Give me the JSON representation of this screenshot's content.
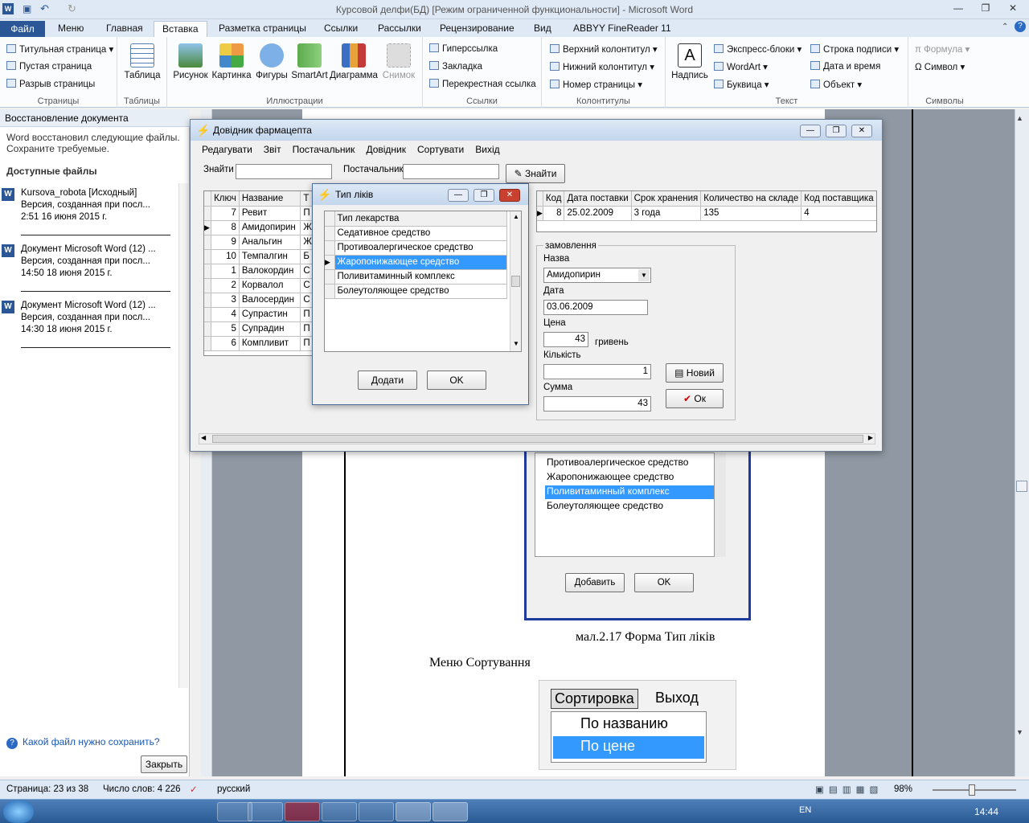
{
  "word": {
    "title": "Курсовой делфи(БД) [Режим ограниченной функциональности] - Microsoft Word",
    "tabs": [
      "Файл",
      "Меню",
      "Главная",
      "Вставка",
      "Разметка страницы",
      "Ссылки",
      "Рассылки",
      "Рецензирование",
      "Вид",
      "ABBYY FineReader 11"
    ],
    "active_tab": "Вставка",
    "ribbon": {
      "pages": {
        "label": "Страницы",
        "items": [
          "Титульная страница",
          "Пустая страница",
          "Разрыв страницы"
        ]
      },
      "tables": {
        "label": "Таблицы",
        "item": "Таблица"
      },
      "illustrations": {
        "label": "Иллюстрации",
        "items": [
          "Рисунок",
          "Картинка",
          "Фигуры",
          "SmartArt",
          "Диаграмма",
          "Снимок"
        ]
      },
      "links": {
        "label": "Ссылки",
        "items": [
          "Гиперссылка",
          "Закладка",
          "Перекрестная ссылка"
        ]
      },
      "headers": {
        "label": "Колонтитулы",
        "items": [
          "Верхний колонтитул",
          "Нижний колонтитул",
          "Номер страницы"
        ]
      },
      "text": {
        "label": "Текст",
        "big": "Надпись",
        "items": [
          "Экспресс-блоки",
          "WordArt",
          "Буквица",
          "Строка подписи",
          "Дата и время",
          "Объект"
        ]
      },
      "symbols": {
        "label": "Символы",
        "items": [
          "Формула",
          "Символ"
        ]
      }
    },
    "recovery": {
      "header": "Восстановление документа",
      "note": [
        "Word восстановил следующие файлы.",
        "Сохраните требуемые."
      ],
      "available": "Доступные файлы",
      "files": [
        {
          "name": "Kursova_robota  [Исходный]",
          "ver": "Версия, созданная при посл...",
          "time": "2:51 16 июня 2015 г."
        },
        {
          "name": "Документ Microsoft Word (12) ...",
          "ver": "Версия, созданная при посл...",
          "time": "14:50 18 июня 2015 г."
        },
        {
          "name": "Документ Microsoft Word (12) ...",
          "ver": "Версия, созданная при посл...",
          "time": "14:30 18 июня 2015 г."
        }
      ],
      "help": "Какой файл нужно сохранить?",
      "close": "Закрыть"
    },
    "page": {
      "bg_list": [
        "Противоалергическое средство",
        "Жаропонижающее средство",
        "Поливитаминный комплекс",
        "Болеутоляющее средство"
      ],
      "bg_btn_add": "Добавить",
      "bg_btn_ok": "OK",
      "caption": "мал.2.17 Форма  Тип ліків",
      "para": "Меню Сортування",
      "img_menu": [
        "Сортировка",
        "Выход"
      ],
      "img_items": [
        "По названию",
        "По цене"
      ]
    },
    "status": {
      "page": "Страница: 23 из 38",
      "words": "Число слов: 4 226",
      "lang": "русский",
      "zoom": "98%"
    },
    "clock": "14:44",
    "tray_lang": "EN"
  },
  "app": {
    "title": "Довідник фармацепта",
    "menu": [
      "Редагувати",
      "Звіт",
      "Постачальник",
      "Довідник",
      "Сортувати",
      "Вихід"
    ],
    "find_label": "Знайти",
    "supplier_label": "Постачальник",
    "find_btn": "Знайти",
    "drugs": {
      "cols": [
        "Ключ",
        "Название",
        "Т"
      ],
      "rows": [
        [
          "7",
          "Ревит",
          "П"
        ],
        [
          "8",
          "Амидопирин",
          "Ж"
        ],
        [
          "9",
          "Анальгин",
          "Ж"
        ],
        [
          "10",
          "Темпалгин",
          "Б"
        ],
        [
          "1",
          "Валокордин",
          "С"
        ],
        [
          "2",
          "Корвалол",
          "С"
        ],
        [
          "3",
          "Валосердин",
          "С"
        ],
        [
          "4",
          "Супрастин",
          "П"
        ],
        [
          "5",
          "Супрадин",
          "П"
        ],
        [
          "6",
          "Компливит",
          "П"
        ]
      ]
    },
    "supply": {
      "cols": [
        "Код",
        "Дата поставки",
        "Срок хранения",
        "Количество на складе",
        "Код поставщика"
      ],
      "rows": [
        [
          "8",
          "25.02.2009",
          "3 года",
          "135",
          "4"
        ]
      ]
    },
    "order": {
      "legend": "замовлення",
      "name_lbl": "Назва",
      "name_val": "Амидопирин",
      "date_lbl": "Дата",
      "date_val": "03.06.2009",
      "price_lbl": "Цена",
      "price_val": "43",
      "currency": "гривень",
      "qty_lbl": "Кількість",
      "qty_val": "1",
      "sum_lbl": "Сумма",
      "sum_val": "43",
      "new_btn": "Новий",
      "ok_btn": "Ок"
    }
  },
  "dialog": {
    "title": "Тип ліків",
    "col": "Тип лекарства",
    "items": [
      "Седативное средство",
      "Противоалергическое средство",
      "Жаропонижающее средство",
      "Поливитаминный комплекс",
      "Болеутоляющее средство"
    ],
    "selected": 2,
    "add_btn": "Додати",
    "ok_btn": "OK"
  }
}
